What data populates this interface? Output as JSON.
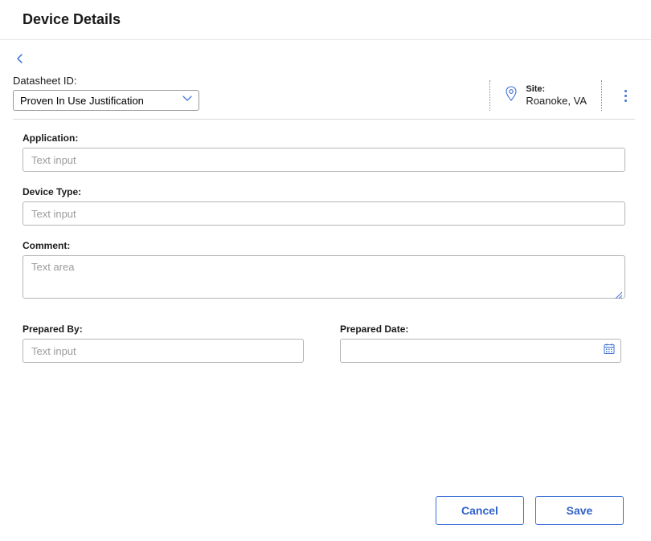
{
  "header": {
    "title": "Device Details"
  },
  "datasheet": {
    "label": "Datasheet ID:",
    "selected": "Proven In Use Justification"
  },
  "site": {
    "label": "Site:",
    "value": "Roanoke, VA"
  },
  "fields": {
    "application": {
      "label": "Application:",
      "placeholder": "Text input"
    },
    "deviceType": {
      "label": "Device Type:",
      "placeholder": "Text input"
    },
    "comment": {
      "label": "Comment:",
      "placeholder": "Text area"
    },
    "preparedBy": {
      "label": "Prepared By:",
      "placeholder": "Text input"
    },
    "preparedDate": {
      "label": "Prepared Date:"
    }
  },
  "buttons": {
    "cancel": "Cancel",
    "save": "Save"
  },
  "colors": {
    "accent": "#3a6fd8"
  }
}
